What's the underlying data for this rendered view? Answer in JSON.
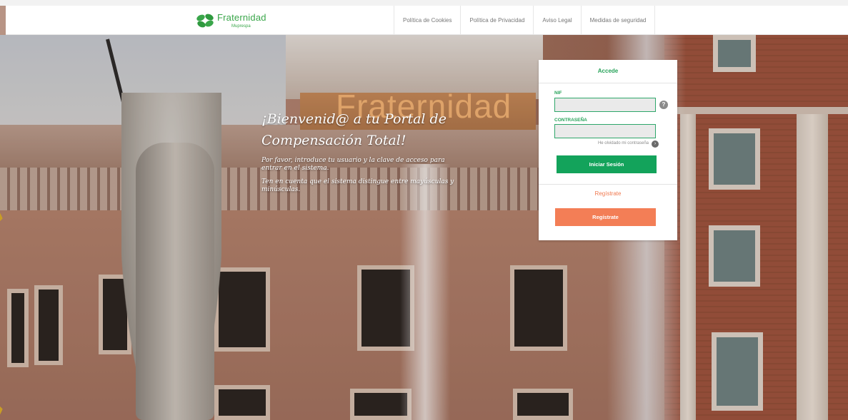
{
  "header": {
    "logo_name": "Fraternidad",
    "logo_sub": "Muprespa",
    "nav": [
      {
        "label": "Política de Cookies"
      },
      {
        "label": "Política de Privacidad"
      },
      {
        "label": "Aviso Legal"
      },
      {
        "label": "Medidas de seguridad"
      }
    ]
  },
  "background": {
    "sign_text": "Fraternidad"
  },
  "welcome": {
    "title": "¡Bienvenid@ a tu Portal de Compensación Total!",
    "line1": "Por favor, introduce tu usuario y la clave de acceso para entrar en el sistema.",
    "line2": "Ten en cuenta que el sistema distingue entre mayúsculas y minúsculas."
  },
  "login": {
    "title": "Accede",
    "nif_label": "NIF",
    "nif_value": "",
    "password_label": "CONTRASEÑA",
    "password_value": "",
    "forgot": "He olvidado mi contraseña",
    "submit": "Iniciar Sesión",
    "register_title": "Regístrate",
    "register_button": "Regístrate"
  },
  "colors": {
    "accent_green": "#13a35b",
    "accent_orange": "#f37e56"
  }
}
